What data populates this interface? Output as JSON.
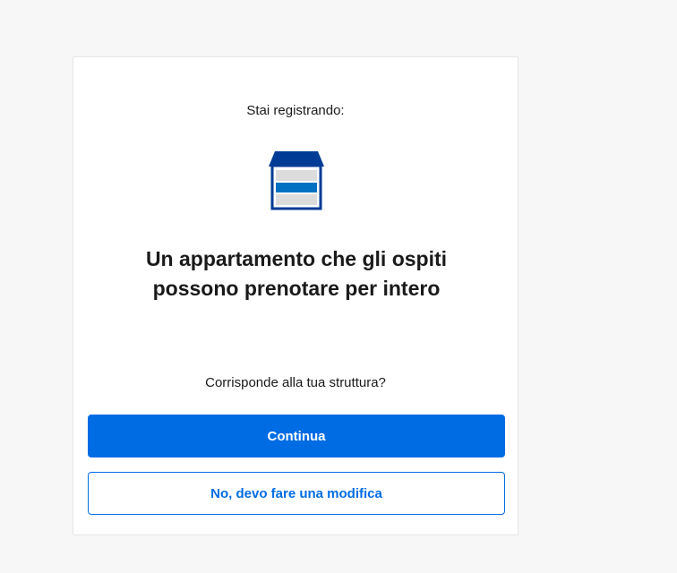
{
  "card": {
    "intro": "Stai registrando:",
    "icon": "apartment-building-icon",
    "heading_line1": "Un appartamento che gli ospiti",
    "heading_line2": "possono prenotare per intero",
    "question": "Corrisponde alla tua struttura?",
    "continue_label": "Continua",
    "modify_label": "No, devo fare una modifica"
  },
  "colors": {
    "primary": "#006ce4",
    "icon_dark": "#003b95",
    "icon_light": "#dcdcdc",
    "page_bg": "#f7f7f7"
  }
}
